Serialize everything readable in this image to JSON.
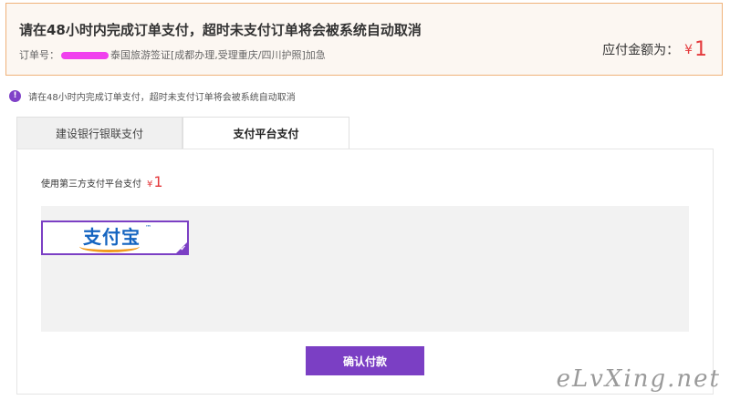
{
  "notice": {
    "title": "请在48小时内完成订单支付，超时未支付订单将会被系统自动取消",
    "order_label": "订单号：",
    "order_desc": "泰国旅游签证[成都办理,受理重庆/四川护照]加急",
    "amount_label": "应付金额为：",
    "amount_currency": "¥",
    "amount_value": "1"
  },
  "tip": {
    "icon": "info-icon",
    "icon_glyph": "!",
    "text": "请在48小时内完成订单支付，超时未支付订单将会被系统自动取消"
  },
  "tabs": [
    {
      "label": "建设银行银联支付",
      "active": false
    },
    {
      "label": "支付平台支付",
      "active": true
    }
  ],
  "panel": {
    "third_party_label": "使用第三方支付平台支付",
    "currency": "¥",
    "amount": "1",
    "methods": [
      {
        "name": "支付宝",
        "tm": "™",
        "selected": true
      }
    ],
    "check_glyph": "✔",
    "confirm_label": "确认付款"
  },
  "watermark": "eLvXing.net",
  "colors": {
    "accent": "#7b3fc4",
    "price": "#e4393c",
    "notice_border": "#f0b27a",
    "alipay_blue": "#1464c0",
    "alipay_orange": "#f29b1d"
  }
}
